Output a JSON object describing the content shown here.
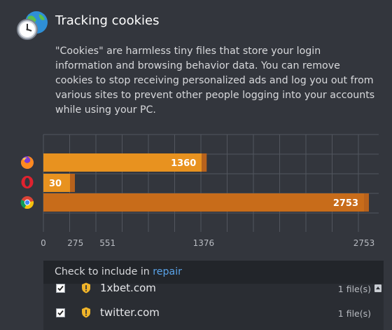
{
  "header": {
    "title": "Tracking cookies",
    "icon": "globe-clock-icon",
    "description": "\"Cookies\" are harmless tiny files that store your login information and browsing behavior data. You can remove cookies to stop receiving personalized ads and log you out from various sites to prevent other people logging into your accounts while using your PC."
  },
  "chart_data": {
    "type": "bar",
    "orientation": "horizontal",
    "categories": [
      "firefox-icon",
      "opera-icon",
      "chrome-icon"
    ],
    "values": [
      1360,
      30,
      2753
    ],
    "bar_colors": [
      "#e8921f",
      "#e8921f",
      "#c86c1a"
    ],
    "x_ticks": [
      0,
      275,
      551,
      1376,
      2753
    ],
    "xlim": [
      0,
      2753
    ],
    "grid": true
  },
  "panel": {
    "header_text": "Check to include in ",
    "header_link": "repair",
    "rows": [
      {
        "site": "1xbet.com",
        "count": "1 file(s)",
        "checked": true
      },
      {
        "site": "twitter.com",
        "count": "1 file(s)",
        "checked": true
      }
    ]
  },
  "colors": {
    "background": "#33363d",
    "accent": "#e8921f",
    "link": "#5aa3e8",
    "warning": "#f0b429"
  }
}
